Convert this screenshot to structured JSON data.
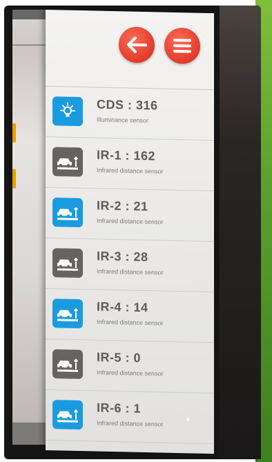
{
  "header": {
    "back_icon": "arrow-left-icon",
    "menu_icon": "hamburger-menu-icon",
    "accent_color": "#e23b2b"
  },
  "sensors": [
    {
      "title": "CDS : 316",
      "subtitle": "Illuminance sensor",
      "icon": "lightbulb-icon",
      "icon_color": "#1a9be0"
    },
    {
      "title": "IR-1 : 162",
      "subtitle": "Infrared distance sensor",
      "icon": "car-distance-icon",
      "icon_color": "#666361"
    },
    {
      "title": "IR-2 : 21",
      "subtitle": "Infrared distance sensor",
      "icon": "car-distance-icon",
      "icon_color": "#1a9be0"
    },
    {
      "title": "IR-3 : 28",
      "subtitle": "Infrared distance sensor",
      "icon": "car-distance-icon",
      "icon_color": "#666361"
    },
    {
      "title": "IR-4 : 14",
      "subtitle": "Infrared distance sensor",
      "icon": "car-distance-icon",
      "icon_color": "#1a9be0"
    },
    {
      "title": "IR-5 : 0",
      "subtitle": "Infrared distance sensor",
      "icon": "car-distance-icon",
      "icon_color": "#666361"
    },
    {
      "title": "IR-6 : 1",
      "subtitle": "Infrared distance sensor",
      "icon": "car-distance-icon",
      "icon_color": "#1a9be0"
    }
  ]
}
